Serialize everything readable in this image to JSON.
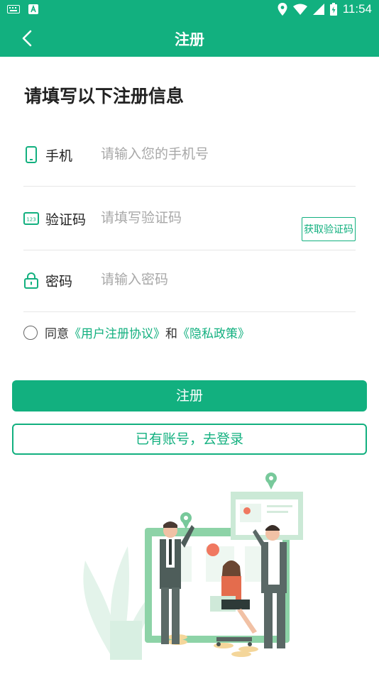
{
  "status_bar": {
    "time": "11:54",
    "icons": [
      "keyboard-icon",
      "text-a-icon",
      "location-icon",
      "wifi-icon",
      "signal-icon",
      "battery-icon"
    ]
  },
  "app_bar": {
    "title": "注册",
    "back_icon": "chevron-left-icon"
  },
  "heading": "请填写以下注册信息",
  "form": {
    "phone": {
      "label": "手机",
      "placeholder": "请输入您的手机号",
      "value": "",
      "icon": "phone-icon"
    },
    "code": {
      "label": "验证码",
      "placeholder": "请填写验证码",
      "value": "",
      "icon": "code-123-icon",
      "get_code_label": "获取验证码"
    },
    "password": {
      "label": "密码",
      "placeholder": "请输入密码",
      "value": "",
      "icon": "lock-icon"
    }
  },
  "agreement": {
    "prefix": "同意",
    "user_agreement": "《用户注册协议》",
    "conjunction": "和",
    "privacy_policy": "《隐私政策》",
    "checked": false
  },
  "buttons": {
    "register": "注册",
    "login": "已有账号，去登录"
  },
  "colors": {
    "primary": "#12b07f",
    "text": "#222222",
    "placeholder": "#a8a8a8",
    "divider": "#e6e6e6"
  }
}
